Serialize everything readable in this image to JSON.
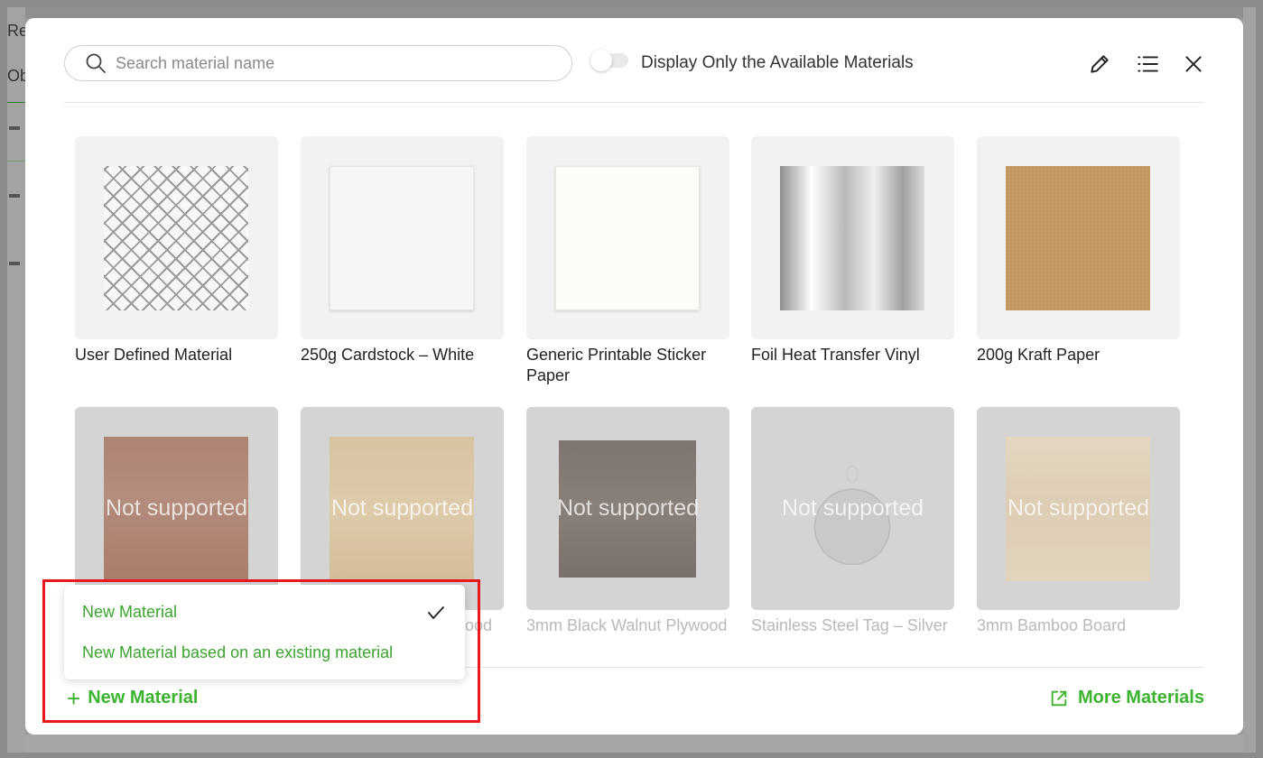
{
  "background": {
    "left_fragments": [
      "Ret",
      "Ob"
    ]
  },
  "search": {
    "placeholder": "Search material name"
  },
  "filter": {
    "label": "Display Only the Available Materials",
    "enabled": false
  },
  "toolbar": {
    "icons": [
      "pencil-icon",
      "list-icon",
      "close-icon"
    ]
  },
  "materials": [
    {
      "name": "User Defined Material",
      "available": true,
      "swatch": "grid"
    },
    {
      "name": "250g Cardstock – White",
      "available": true,
      "swatch": "white"
    },
    {
      "name": "Generic Printable Sticker Paper",
      "available": true,
      "swatch": "sticker"
    },
    {
      "name": "Foil Heat Transfer Vinyl",
      "available": true,
      "swatch": "foil"
    },
    {
      "name": "200g Kraft Paper",
      "available": true,
      "swatch": "kraft"
    },
    {
      "name": "",
      "available": false,
      "swatch": "cherry",
      "overlay": "Not supported"
    },
    {
      "name": "ood",
      "available": false,
      "swatch": "bass",
      "overlay": "Not supported"
    },
    {
      "name": "3mm Black Walnut Plywood",
      "available": false,
      "swatch": "walnut",
      "overlay": "Not supported"
    },
    {
      "name": "Stainless Steel Tag – Silver",
      "available": false,
      "swatch": "tag",
      "overlay": "Not supported"
    },
    {
      "name": "3mm Bamboo Board",
      "available": false,
      "swatch": "bamboo",
      "overlay": "Not supported"
    }
  ],
  "dropdown": {
    "items": [
      {
        "label": "New Material",
        "selected": true
      },
      {
        "label": "New Material based on an existing material",
        "selected": false
      }
    ]
  },
  "footer": {
    "new_material_label": "New Material",
    "more_materials_label": "More Materials"
  },
  "colors": {
    "accent": "#3cb32e",
    "highlight": "#e8191c"
  }
}
